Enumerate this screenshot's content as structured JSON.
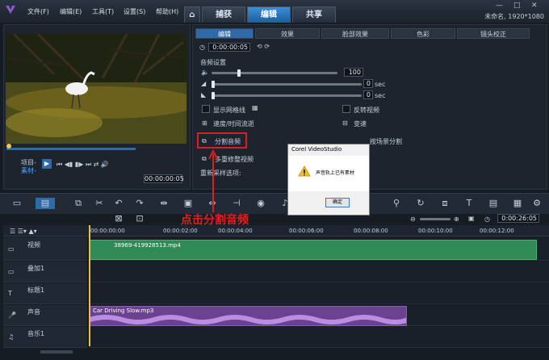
{
  "menu": {
    "file": "文件(F)",
    "edit": "编辑(E)",
    "tools": "工具(T)",
    "settings": "设置(S)",
    "help": "帮助(H)"
  },
  "main_tabs": {
    "capture": "捕获",
    "edit": "编辑",
    "share": "共享"
  },
  "project_info": "未命名, 1920*1080",
  "sub_tabs": [
    "编辑",
    "效果",
    "脸部效果",
    "色彩",
    "镜头校正"
  ],
  "timecode_top": "0:00:00:05",
  "audio_settings": {
    "title": "音频设置",
    "volume": "100",
    "fade_in": "0",
    "fade_out": "0",
    "unit": "sec"
  },
  "options": {
    "show_grid": "显示网格线",
    "speed_time": "速度/时间流逝",
    "split_audio": "分割音频",
    "multi_trim": "多重修整视频",
    "resample": "重新采样选项:",
    "reverse": "反转视频",
    "speed_change": "变速",
    "split_by_scene": "按场景分割"
  },
  "preview": {
    "project": "项目-",
    "clip": "素材-",
    "timecode": "00:00:00:05"
  },
  "timeline": {
    "timecode": "0:00:26:05",
    "ruler": [
      "00:00:00:00",
      "00:00:02:00",
      "00:00:04:00",
      "00:00:06:00",
      "00:00:08:00",
      "00:00:10:00",
      "00:00:12:00"
    ],
    "tracks": [
      {
        "name": "视频"
      },
      {
        "name": "叠加1"
      },
      {
        "name": "标题1"
      },
      {
        "name": "声音"
      },
      {
        "name": "音乐1"
      }
    ],
    "video_clip": "38969-419928513.mp4",
    "audio_clip": "Car Driving Slow.mp3"
  },
  "dialog": {
    "title": "Corel VideoStudio",
    "message": "声音轨上已有素材",
    "ok": "确定"
  },
  "annotation": "点击分割音频",
  "colors": {
    "accent": "#2f6aa8",
    "highlight": "#d9201f",
    "video_clip": "#2f8a55",
    "audio_clip": "#6a4290"
  }
}
